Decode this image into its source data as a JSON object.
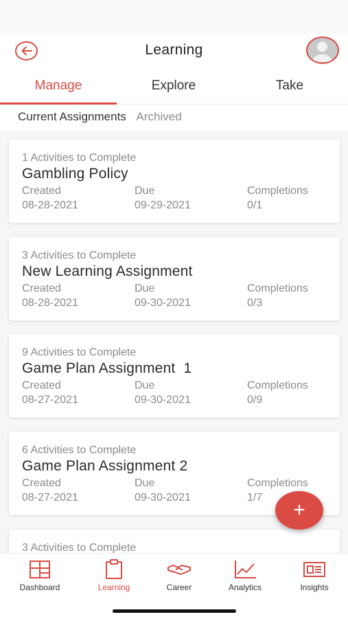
{
  "header": {
    "title": "Learning"
  },
  "tabs": [
    {
      "label": "Manage",
      "active": true
    },
    {
      "label": "Explore",
      "active": false
    },
    {
      "label": "Take",
      "active": false
    }
  ],
  "subtabs": [
    {
      "label": "Current Assignments",
      "active": true
    },
    {
      "label": "Archived",
      "active": false
    }
  ],
  "assignments": [
    {
      "activities": "1 Activities to Complete",
      "title": "Gambling Policy",
      "created_label": "Created",
      "created": "08-28-2021",
      "due_label": "Due",
      "due": "09-29-2021",
      "completions_label": "Completions",
      "completions": "0/1"
    },
    {
      "activities": "3 Activities to Complete",
      "title": "New Learning Assignment",
      "created_label": "Created",
      "created": "08-28-2021",
      "due_label": "Due",
      "due": "09-30-2021",
      "completions_label": "Completions",
      "completions": "0/3"
    },
    {
      "activities": "9 Activities to Complete",
      "title": "Game Plan Assignment  1",
      "created_label": "Created",
      "created": "08-27-2021",
      "due_label": "Due",
      "due": "09-30-2021",
      "completions_label": "Completions",
      "completions": "0/9"
    },
    {
      "activities": "6 Activities to Complete",
      "title": "Game Plan Assignment 2",
      "created_label": "Created",
      "created": "08-27-2021",
      "due_label": "Due",
      "due": "09-30-2021",
      "completions_label": "Completions",
      "completions": "1/7"
    },
    {
      "activities": "3 Activities to Complete"
    }
  ],
  "fab": {
    "label": "+"
  },
  "bottom_nav": [
    {
      "label": "Dashboard",
      "icon": "dashboard-icon",
      "active": false
    },
    {
      "label": "Learning",
      "icon": "clipboard-icon",
      "active": true
    },
    {
      "label": "Career",
      "icon": "handshake-icon",
      "active": false
    },
    {
      "label": "Analytics",
      "icon": "chart-icon",
      "active": false
    },
    {
      "label": "Insights",
      "icon": "newspaper-icon",
      "active": false
    }
  ],
  "colors": {
    "accent": "#d94b43",
    "text": "#333333",
    "muted": "#8a8a8a",
    "background": "#f6f6f6"
  }
}
